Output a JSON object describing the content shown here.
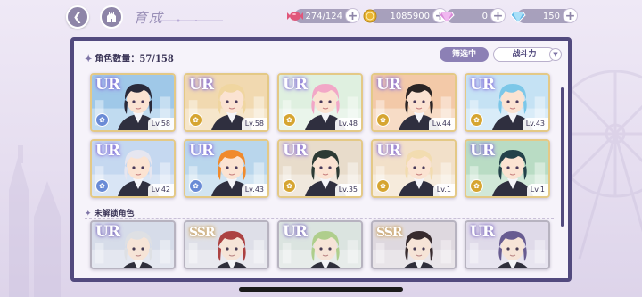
{
  "header": {
    "title": "育成",
    "resources": [
      {
        "name": "stamina",
        "icon": "candy-icon",
        "value": "274/124",
        "color": "#e0567a"
      },
      {
        "name": "gold",
        "icon": "coin-icon",
        "value": "1085900",
        "color": "#e9b532"
      },
      {
        "name": "gems-paid",
        "icon": "diamond-pink-icon",
        "value": "0",
        "color": "#d88ad8"
      },
      {
        "name": "gems-free",
        "icon": "diamond-blue-icon",
        "value": "150",
        "color": "#5fb7e8"
      }
    ]
  },
  "panel": {
    "count_label": "角色数量：57/158",
    "filter_label": "筛选中",
    "sort_label": "战斗力",
    "locked_section_label": "未解锁角色"
  },
  "cards_owned": [
    {
      "rarity": "UR",
      "level": "Lv.58",
      "element": "fire",
      "elem_color": "#6a8bd6",
      "hair": "#2a2a3a",
      "bg": "#9fc8e8"
    },
    {
      "rarity": "UR",
      "level": "Lv.58",
      "element": "earth",
      "elem_color": "#d6a531",
      "hair": "#f0d6a0",
      "bg": "#f1d9b0"
    },
    {
      "rarity": "UR",
      "level": "Lv.48",
      "element": "earth",
      "elem_color": "#d6a531",
      "hair": "#f2a7c7",
      "bg": "#dff0e0"
    },
    {
      "rarity": "UR",
      "level": "Lv.44",
      "element": "earth",
      "elem_color": "#d6a531",
      "hair": "#2a2424",
      "bg": "#f3c9a8"
    },
    {
      "rarity": "UR",
      "level": "Lv.43",
      "element": "water",
      "elem_color": "#d6a531",
      "hair": "#7cc7e8",
      "bg": "#c5e2f4"
    },
    {
      "rarity": "UR",
      "level": "Lv.42",
      "element": "water",
      "elem_color": "#6a8bd6",
      "hair": "#e6e6f0",
      "bg": "#c5d8f0"
    },
    {
      "rarity": "UR",
      "level": "Lv.43",
      "element": "fire",
      "elem_color": "#6a8bd6",
      "hair": "#f08a2c",
      "bg": "#b9d6ec"
    },
    {
      "rarity": "UR",
      "level": "Lv.35",
      "element": "earth",
      "elem_color": "#d6a531",
      "hair": "#2c3a34",
      "bg": "#e8dccb"
    },
    {
      "rarity": "UR",
      "level": "Lv.1",
      "element": "fire",
      "elem_color": "#d6a531",
      "hair": "#f2dcb0",
      "bg": "#f2e0c9"
    },
    {
      "rarity": "UR",
      "level": "Lv.1",
      "element": "earth",
      "elem_color": "#d6a531",
      "hair": "#24424a",
      "bg": "#b9dcc4"
    }
  ],
  "cards_locked": [
    {
      "rarity": "UR",
      "hair": "#dde0e6",
      "bg": "#c9d5e8"
    },
    {
      "rarity": "SSR",
      "hair": "#c83a3a",
      "bg": "#d6d9e4"
    },
    {
      "rarity": "UR",
      "hair": "#a8d27a",
      "bg": "#cfe0d6"
    },
    {
      "rarity": "SSR",
      "hair": "#3a2a2e",
      "bg": "#d9cfd8"
    },
    {
      "rarity": "UR",
      "hair": "#6a5aa0",
      "bg": "#d8d0e8"
    }
  ]
}
